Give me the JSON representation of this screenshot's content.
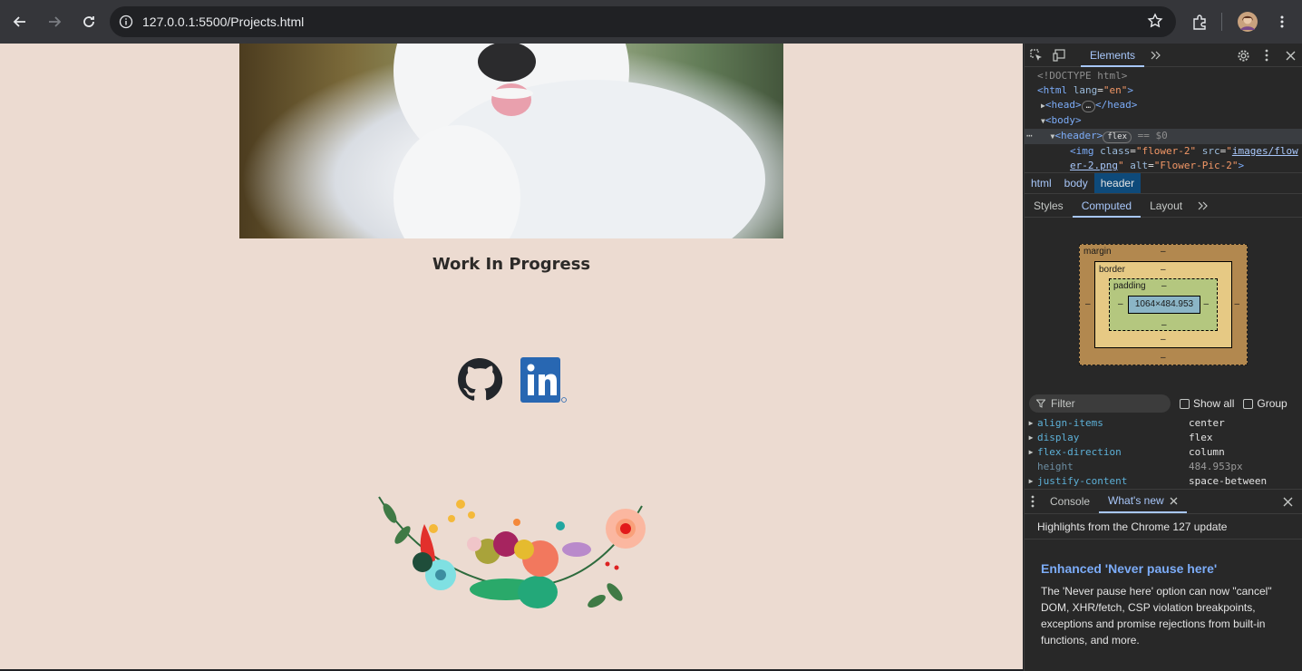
{
  "browser": {
    "url": "127.0.0.1:5500/Projects.html"
  },
  "page": {
    "work_in_progress": "Work In Progress"
  },
  "devtools": {
    "tabs": [
      "Elements"
    ],
    "dom": {
      "doctype": "<!DOCTYPE html>",
      "html_open": "<html",
      "html_attr": "lang",
      "html_val": "\"en\"",
      "head_open": "<head>",
      "head_close": "</head>",
      "body": "<body>",
      "header": "<header>",
      "header_badge": "flex",
      "header_eq": "== $0",
      "img_tag": "<img",
      "img_class_attr": "class",
      "img_class_val": "\"flower-2\"",
      "img_src_attr": "src",
      "img_src_val_1": "images/flow",
      "img_src_val_2": "er-2.png",
      "img_alt_attr": "alt",
      "img_alt_val": "\"Flower-Pic-2\"",
      "img_close": ">"
    },
    "breadcrumbs": [
      "html",
      "body",
      "header"
    ],
    "subtabs": [
      "Styles",
      "Computed",
      "Layout"
    ],
    "boxmodel": {
      "margin_label": "margin",
      "border_label": "border",
      "padding_label": "padding",
      "dash": "–",
      "content": "1064×484.953"
    },
    "filter_placeholder": "Filter",
    "show_all": "Show all",
    "group": "Group",
    "computed": [
      {
        "name": "align-items",
        "value": "center"
      },
      {
        "name": "display",
        "value": "flex"
      },
      {
        "name": "flex-direction",
        "value": "column"
      },
      {
        "name": "height",
        "value": "484.953px"
      },
      {
        "name": "justify-content",
        "value": "space-between"
      }
    ],
    "drawer": {
      "console": "Console",
      "whats_new": "What's new",
      "highlights": "Highlights from the Chrome 127 update",
      "news_title": "Enhanced 'Never pause here'",
      "news_body": "The 'Never pause here' option can now \"cancel\" DOM, XHR/fetch, CSP violation breakpoints, exceptions and promise rejections from built-in functions, and more."
    }
  }
}
